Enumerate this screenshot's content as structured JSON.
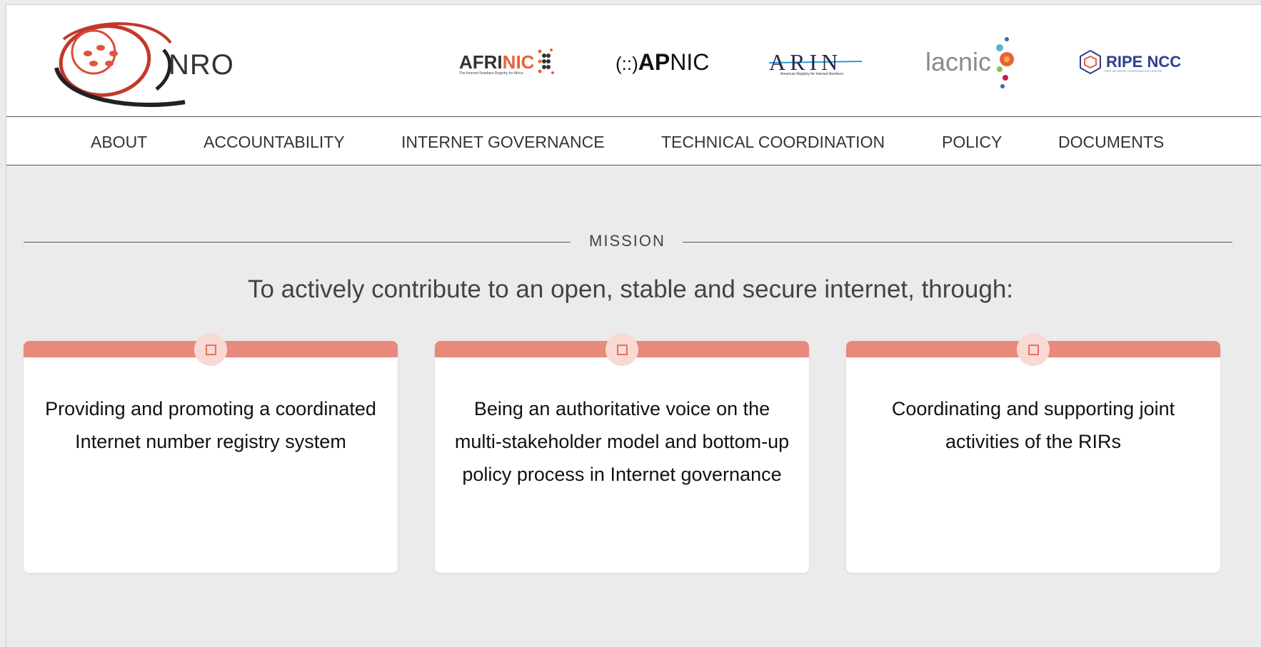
{
  "site": {
    "logo_text": "NRO",
    "colors": {
      "accent": "#e8897b",
      "accent_dark": "#e07461",
      "badge_bg": "#f8d9d3",
      "page_bg": "#ebebeb"
    }
  },
  "rirs": [
    {
      "name_main": "AFRI",
      "name_accent": "NIC",
      "tagline": "The Internet Numbers Registry for Africa"
    },
    {
      "name_prefix": "(::)",
      "name_bold": "AP",
      "name_rest": "NIC"
    },
    {
      "name": "ARIN",
      "tagline": "American Registry for Internet Numbers"
    },
    {
      "name": "lacnic"
    },
    {
      "name": "RIPE NCC",
      "tagline": "RIPE NETWORK COORDINATION CENTRE"
    }
  ],
  "nav": {
    "items": [
      "ABOUT",
      "ACCOUNTABILITY",
      "INTERNET GOVERNANCE",
      "TECHNICAL COORDINATION",
      "POLICY",
      "DOCUMENTS"
    ]
  },
  "mission": {
    "label": "MISSION",
    "tagline": "To actively contribute to an open, stable and secure internet, through:",
    "cards": [
      {
        "icon": "square-icon",
        "text": "Providing and promoting a coordinated Internet number registry system"
      },
      {
        "icon": "square-icon",
        "text": "Being an authoritative voice on the multi-stakeholder model and bottom-up policy process in Internet governance"
      },
      {
        "icon": "square-icon",
        "text": "Coordinating and supporting joint activities of the RIRs"
      }
    ]
  }
}
